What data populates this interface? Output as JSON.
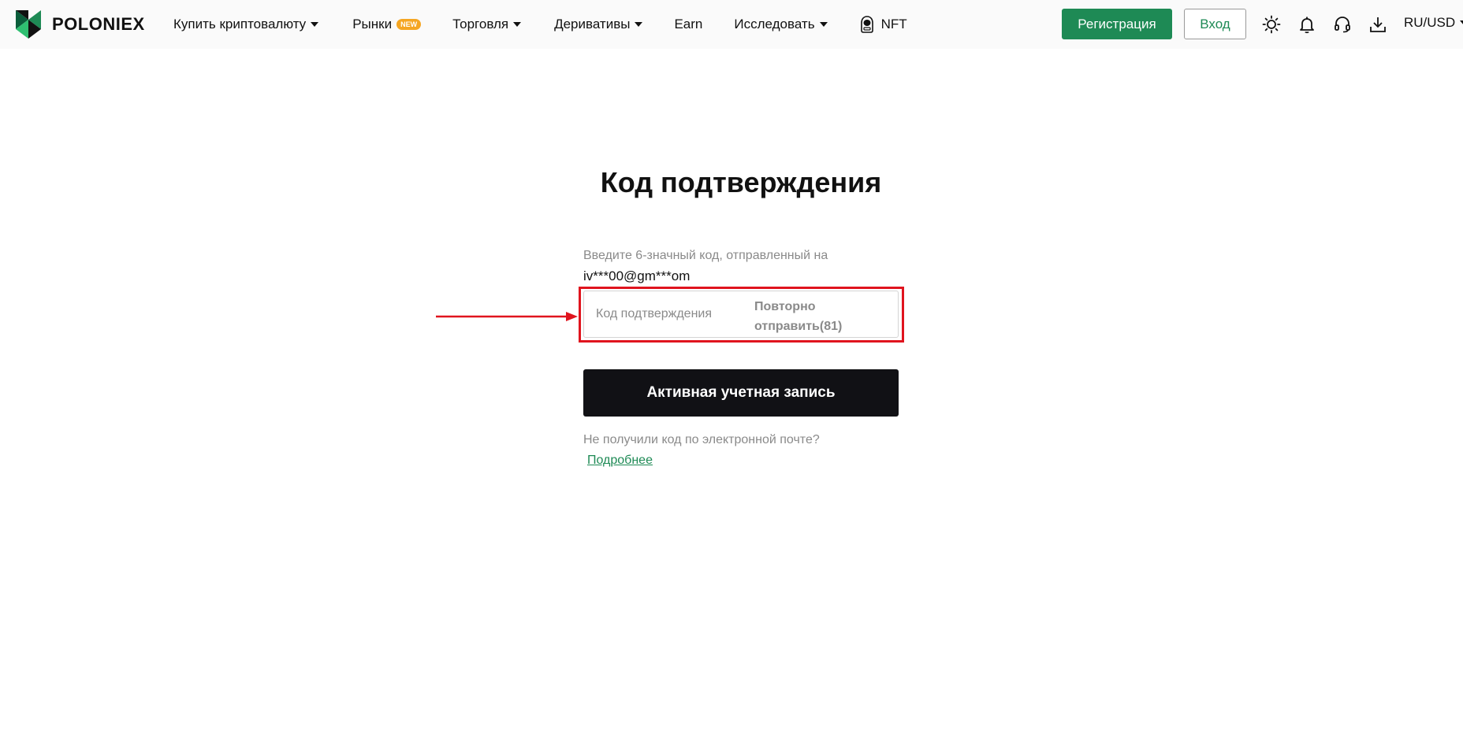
{
  "brand": {
    "name": "POLONIEX",
    "color": "#1e8a55"
  },
  "nav": {
    "items": [
      {
        "label": "Купить криптовалюту",
        "dropdown": true
      },
      {
        "label": "Рынки",
        "badge": "NEW"
      },
      {
        "label": "Торговля",
        "dropdown": true
      },
      {
        "label": "Деривативы",
        "dropdown": true
      },
      {
        "label": "Earn"
      },
      {
        "label": "Исследовать",
        "dropdown": true
      },
      {
        "label": "NFT",
        "icon": "nft-astronaut-icon"
      }
    ]
  },
  "header": {
    "register_label": "Регистрация",
    "login_label": "Вход",
    "icons": [
      "theme-sun-icon",
      "bell-icon",
      "headset-icon",
      "download-icon"
    ],
    "language_currency": "RU/USD"
  },
  "verify": {
    "title": "Код подтверждения",
    "hint": "Введите 6-значный код, отправленный на",
    "email": "iv***00@gm***om",
    "code_value": "",
    "code_placeholder": "Код подтверждения",
    "resend_label_line1": "Повторно",
    "resend_label_line2": "отправить(81)",
    "submit_label": "Активная учетная запись",
    "no_code_text": "Не получили код по электронной почте?",
    "more_link": "Подробнее"
  },
  "annotation": {
    "highlight_color": "#e0141e"
  }
}
